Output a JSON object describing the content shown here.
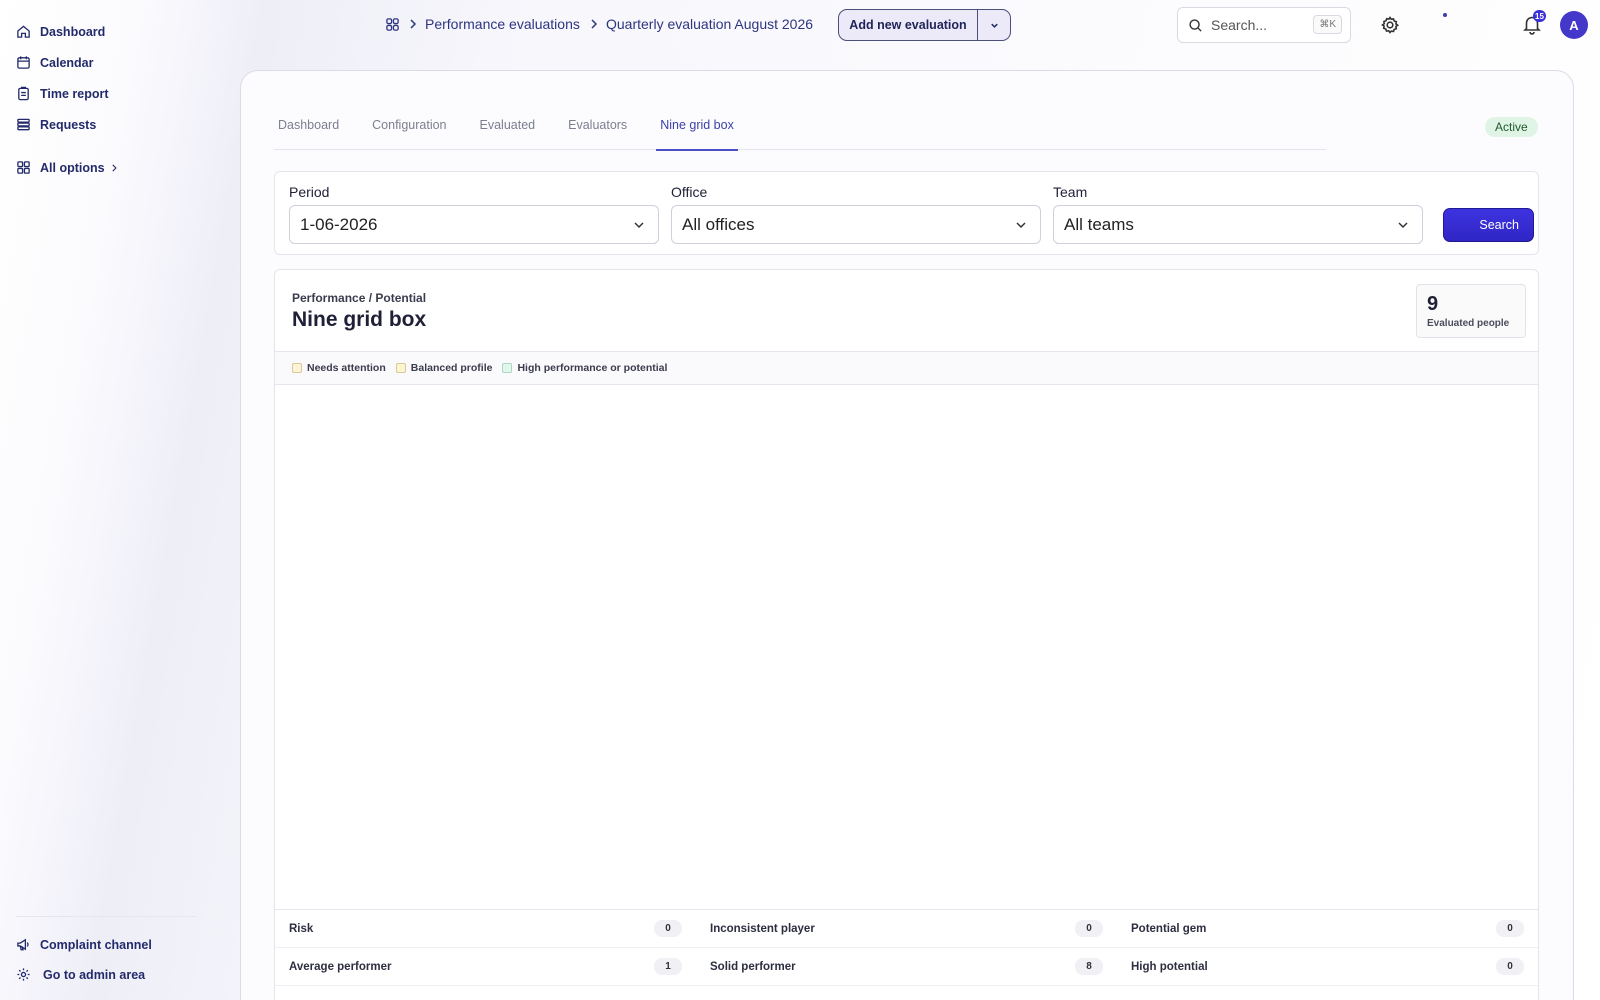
{
  "sidebar": {
    "items": [
      {
        "label": "Dashboard",
        "icon": "home-icon"
      },
      {
        "label": "Calendar",
        "icon": "calendar-icon"
      },
      {
        "label": "Time report",
        "icon": "clipboard-icon"
      },
      {
        "label": "Requests",
        "icon": "list-icon"
      },
      {
        "label": "All options",
        "icon": "grid-icon"
      }
    ],
    "footer": [
      {
        "label": "Complaint channel",
        "icon": "megaphone-icon"
      },
      {
        "label": "Go to admin area",
        "icon": "gear-icon"
      }
    ]
  },
  "header": {
    "breadcrumbs": [
      "Performance evaluations",
      "Quarterly evaluation August 2026"
    ],
    "add_button": "Add new evaluation",
    "search_placeholder": "Search...",
    "search_shortcut": "⌘K",
    "notification_count": "15",
    "avatar_initial": "A"
  },
  "tabs": [
    "Dashboard",
    "Configuration",
    "Evaluated",
    "Evaluators",
    "Nine grid box"
  ],
  "active_tab": "Nine grid box",
  "status": "Active",
  "filters": {
    "period": {
      "label": "Period",
      "value": "1-06-2026"
    },
    "office": {
      "label": "Office",
      "value": "All offices"
    },
    "team": {
      "label": "Team",
      "value": "All teams"
    },
    "search_button": "Search"
  },
  "grid": {
    "subtitle": "Performance / Potential",
    "title": "Nine grid box",
    "evaluated_count": "9",
    "evaluated_label": "Evaluated people",
    "legend": [
      {
        "label": "Needs attention",
        "color": "#fdf3d8"
      },
      {
        "label": "Balanced profile",
        "color": "#fbf6cf"
      },
      {
        "label": "High performance or potential",
        "color": "#e3f6ee"
      }
    ],
    "summary": [
      [
        {
          "label": "Risk",
          "count": "0"
        },
        {
          "label": "Inconsistent player",
          "count": "0"
        },
        {
          "label": "Potential gem",
          "count": "0"
        }
      ],
      [
        {
          "label": "Average performer",
          "count": "1"
        },
        {
          "label": "Solid performer",
          "count": "8"
        },
        {
          "label": "High potential",
          "count": "0"
        }
      ]
    ]
  },
  "colors": {
    "accent": "#3b32d6",
    "nav_text": "#232a6b",
    "active_badge": "#dff4e4"
  }
}
